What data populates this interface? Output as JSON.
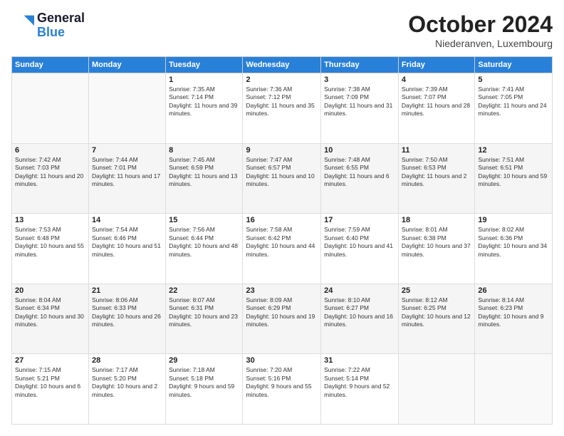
{
  "header": {
    "logo_line1": "General",
    "logo_line2": "Blue",
    "month_title": "October 2024",
    "location": "Niederanven, Luxembourg"
  },
  "days_of_week": [
    "Sunday",
    "Monday",
    "Tuesday",
    "Wednesday",
    "Thursday",
    "Friday",
    "Saturday"
  ],
  "weeks": [
    [
      {
        "day": "",
        "info": ""
      },
      {
        "day": "",
        "info": ""
      },
      {
        "day": "1",
        "info": "Sunrise: 7:35 AM\nSunset: 7:14 PM\nDaylight: 11 hours and 39 minutes."
      },
      {
        "day": "2",
        "info": "Sunrise: 7:36 AM\nSunset: 7:12 PM\nDaylight: 11 hours and 35 minutes."
      },
      {
        "day": "3",
        "info": "Sunrise: 7:38 AM\nSunset: 7:09 PM\nDaylight: 11 hours and 31 minutes."
      },
      {
        "day": "4",
        "info": "Sunrise: 7:39 AM\nSunset: 7:07 PM\nDaylight: 11 hours and 28 minutes."
      },
      {
        "day": "5",
        "info": "Sunrise: 7:41 AM\nSunset: 7:05 PM\nDaylight: 11 hours and 24 minutes."
      }
    ],
    [
      {
        "day": "6",
        "info": "Sunrise: 7:42 AM\nSunset: 7:03 PM\nDaylight: 11 hours and 20 minutes."
      },
      {
        "day": "7",
        "info": "Sunrise: 7:44 AM\nSunset: 7:01 PM\nDaylight: 11 hours and 17 minutes."
      },
      {
        "day": "8",
        "info": "Sunrise: 7:45 AM\nSunset: 6:59 PM\nDaylight: 11 hours and 13 minutes."
      },
      {
        "day": "9",
        "info": "Sunrise: 7:47 AM\nSunset: 6:57 PM\nDaylight: 11 hours and 10 minutes."
      },
      {
        "day": "10",
        "info": "Sunrise: 7:48 AM\nSunset: 6:55 PM\nDaylight: 11 hours and 6 minutes."
      },
      {
        "day": "11",
        "info": "Sunrise: 7:50 AM\nSunset: 6:53 PM\nDaylight: 11 hours and 2 minutes."
      },
      {
        "day": "12",
        "info": "Sunrise: 7:51 AM\nSunset: 6:51 PM\nDaylight: 10 hours and 59 minutes."
      }
    ],
    [
      {
        "day": "13",
        "info": "Sunrise: 7:53 AM\nSunset: 6:48 PM\nDaylight: 10 hours and 55 minutes."
      },
      {
        "day": "14",
        "info": "Sunrise: 7:54 AM\nSunset: 6:46 PM\nDaylight: 10 hours and 51 minutes."
      },
      {
        "day": "15",
        "info": "Sunrise: 7:56 AM\nSunset: 6:44 PM\nDaylight: 10 hours and 48 minutes."
      },
      {
        "day": "16",
        "info": "Sunrise: 7:58 AM\nSunset: 6:42 PM\nDaylight: 10 hours and 44 minutes."
      },
      {
        "day": "17",
        "info": "Sunrise: 7:59 AM\nSunset: 6:40 PM\nDaylight: 10 hours and 41 minutes."
      },
      {
        "day": "18",
        "info": "Sunrise: 8:01 AM\nSunset: 6:38 PM\nDaylight: 10 hours and 37 minutes."
      },
      {
        "day": "19",
        "info": "Sunrise: 8:02 AM\nSunset: 6:36 PM\nDaylight: 10 hours and 34 minutes."
      }
    ],
    [
      {
        "day": "20",
        "info": "Sunrise: 8:04 AM\nSunset: 6:34 PM\nDaylight: 10 hours and 30 minutes."
      },
      {
        "day": "21",
        "info": "Sunrise: 8:06 AM\nSunset: 6:33 PM\nDaylight: 10 hours and 26 minutes."
      },
      {
        "day": "22",
        "info": "Sunrise: 8:07 AM\nSunset: 6:31 PM\nDaylight: 10 hours and 23 minutes."
      },
      {
        "day": "23",
        "info": "Sunrise: 8:09 AM\nSunset: 6:29 PM\nDaylight: 10 hours and 19 minutes."
      },
      {
        "day": "24",
        "info": "Sunrise: 8:10 AM\nSunset: 6:27 PM\nDaylight: 10 hours and 16 minutes."
      },
      {
        "day": "25",
        "info": "Sunrise: 8:12 AM\nSunset: 6:25 PM\nDaylight: 10 hours and 12 minutes."
      },
      {
        "day": "26",
        "info": "Sunrise: 8:14 AM\nSunset: 6:23 PM\nDaylight: 10 hours and 9 minutes."
      }
    ],
    [
      {
        "day": "27",
        "info": "Sunrise: 7:15 AM\nSunset: 5:21 PM\nDaylight: 10 hours and 6 minutes."
      },
      {
        "day": "28",
        "info": "Sunrise: 7:17 AM\nSunset: 5:20 PM\nDaylight: 10 hours and 2 minutes."
      },
      {
        "day": "29",
        "info": "Sunrise: 7:18 AM\nSunset: 5:18 PM\nDaylight: 9 hours and 59 minutes."
      },
      {
        "day": "30",
        "info": "Sunrise: 7:20 AM\nSunset: 5:16 PM\nDaylight: 9 hours and 55 minutes."
      },
      {
        "day": "31",
        "info": "Sunrise: 7:22 AM\nSunset: 5:14 PM\nDaylight: 9 hours and 52 minutes."
      },
      {
        "day": "",
        "info": ""
      },
      {
        "day": "",
        "info": ""
      }
    ]
  ]
}
